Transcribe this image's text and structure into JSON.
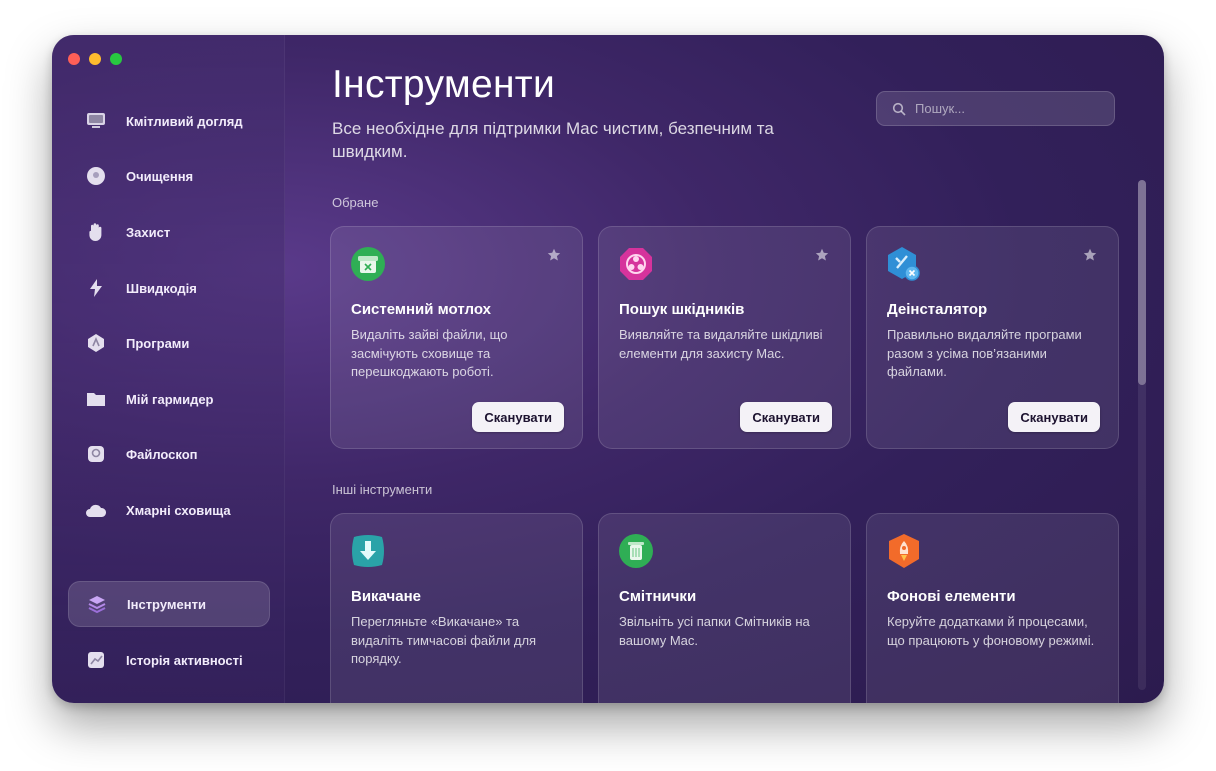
{
  "window": {
    "controls": [
      "close",
      "minimize",
      "zoom"
    ]
  },
  "sidebar": {
    "items": [
      {
        "label": "Кмітливий догляд",
        "icon": "monitor-icon",
        "active": false
      },
      {
        "label": "Очищення",
        "icon": "disk-icon",
        "active": false
      },
      {
        "label": "Захист",
        "icon": "hand-icon",
        "active": false
      },
      {
        "label": "Швидкодія",
        "icon": "lightning-icon",
        "active": false
      },
      {
        "label": "Програми",
        "icon": "apps-icon",
        "active": false
      },
      {
        "label": "Мій гармидер",
        "icon": "folder-icon",
        "active": false
      },
      {
        "label": "Файлоскоп",
        "icon": "lens-icon",
        "active": false
      },
      {
        "label": "Хмарні сховища",
        "icon": "cloud-icon",
        "active": false
      },
      {
        "label": "Інструменти",
        "icon": "layers-icon",
        "active": true
      },
      {
        "label": "Історія активності",
        "icon": "chart-icon",
        "active": false
      }
    ]
  },
  "header": {
    "title": "Інструменти",
    "subtitle": "Все необхідне для підтримки Mac чистим, безпечним та швидким."
  },
  "search": {
    "placeholder": "Пошук...",
    "value": ""
  },
  "sections": {
    "favorites": {
      "label": "Обране",
      "cards": [
        {
          "title": "Системний мотлох",
          "description": "Видаліть зайві файли, що засмічують сховище та перешкоджають роботі.",
          "button": "Сканувати",
          "icon": "trash-bin-icon",
          "starred": true
        },
        {
          "title": "Пошук шкідників",
          "description": "Виявляйте та видаляйте шкідливі елементи для захисту Mac.",
          "button": "Сканувати",
          "icon": "biohazard-icon",
          "starred": true
        },
        {
          "title": "Деінсталятор",
          "description": "Правильно видаляйте програми разом з усіма пов’язаними файлами.",
          "button": "Сканувати",
          "icon": "uninstaller-icon",
          "starred": true
        }
      ]
    },
    "others": {
      "label": "Інші інструменти",
      "cards": [
        {
          "title": "Викачане",
          "description": "Перегляньте «Викачане» та видаліть тимчасові файли для порядку.",
          "icon": "download-icon"
        },
        {
          "title": "Смітнички",
          "description": "Звільніть усі папки Смітників на вашому Mac.",
          "icon": "trash-can-icon"
        },
        {
          "title": "Фонові елементи",
          "description": "Керуйте додатками й процесами, що працюють у фоновому режимі.",
          "icon": "rocket-icon"
        }
      ]
    }
  },
  "colors": {
    "accent_green": "#2fae55",
    "accent_pink": "#d6339c",
    "accent_blue": "#2f8fd6",
    "accent_orange": "#f26b2a"
  }
}
